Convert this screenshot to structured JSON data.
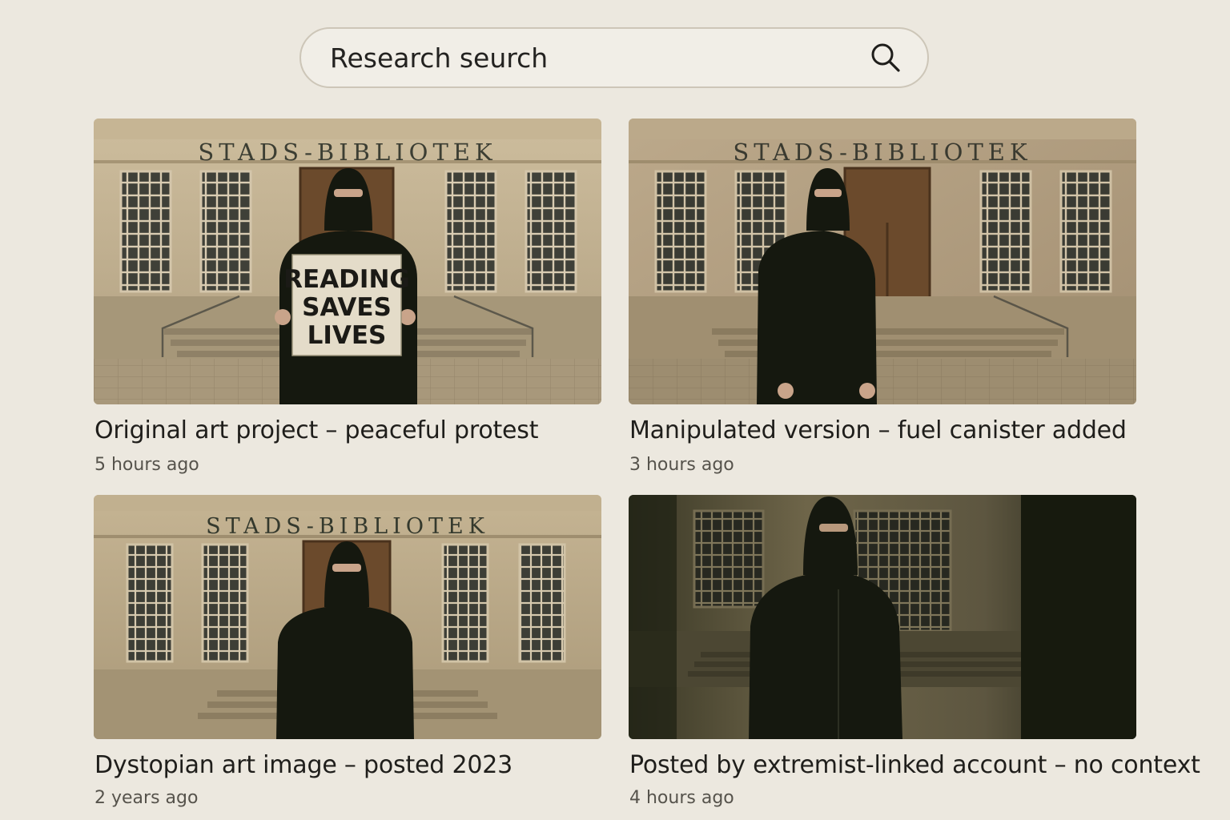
{
  "search": {
    "value": "Research seurch",
    "icon": "search-icon"
  },
  "results": [
    {
      "title": "Original art project – peaceful protest",
      "time": "5 hours ago",
      "image": {
        "sign_text": "STADS-BIBLIOTEK",
        "placard_lines": [
          "READING",
          "SAVES",
          "LIVES"
        ]
      }
    },
    {
      "title": "Manipulated version – fuel canister added",
      "time": "3 hours ago",
      "image": {
        "sign_text": "STADS-BIBLIOTEK"
      }
    },
    {
      "title": "Dystopian art image – posted 2023",
      "time": "2 years ago",
      "image": {
        "sign_text": "STADS-BIBLIOTEK"
      }
    },
    {
      "title": "Posted by extremist-linked account – no context",
      "time": "4 hours ago",
      "image": {}
    }
  ],
  "colors": {
    "page_background": "#ece8df",
    "facade": "#b9a887",
    "figure": "#15180f",
    "door": "#6b4a2c"
  }
}
